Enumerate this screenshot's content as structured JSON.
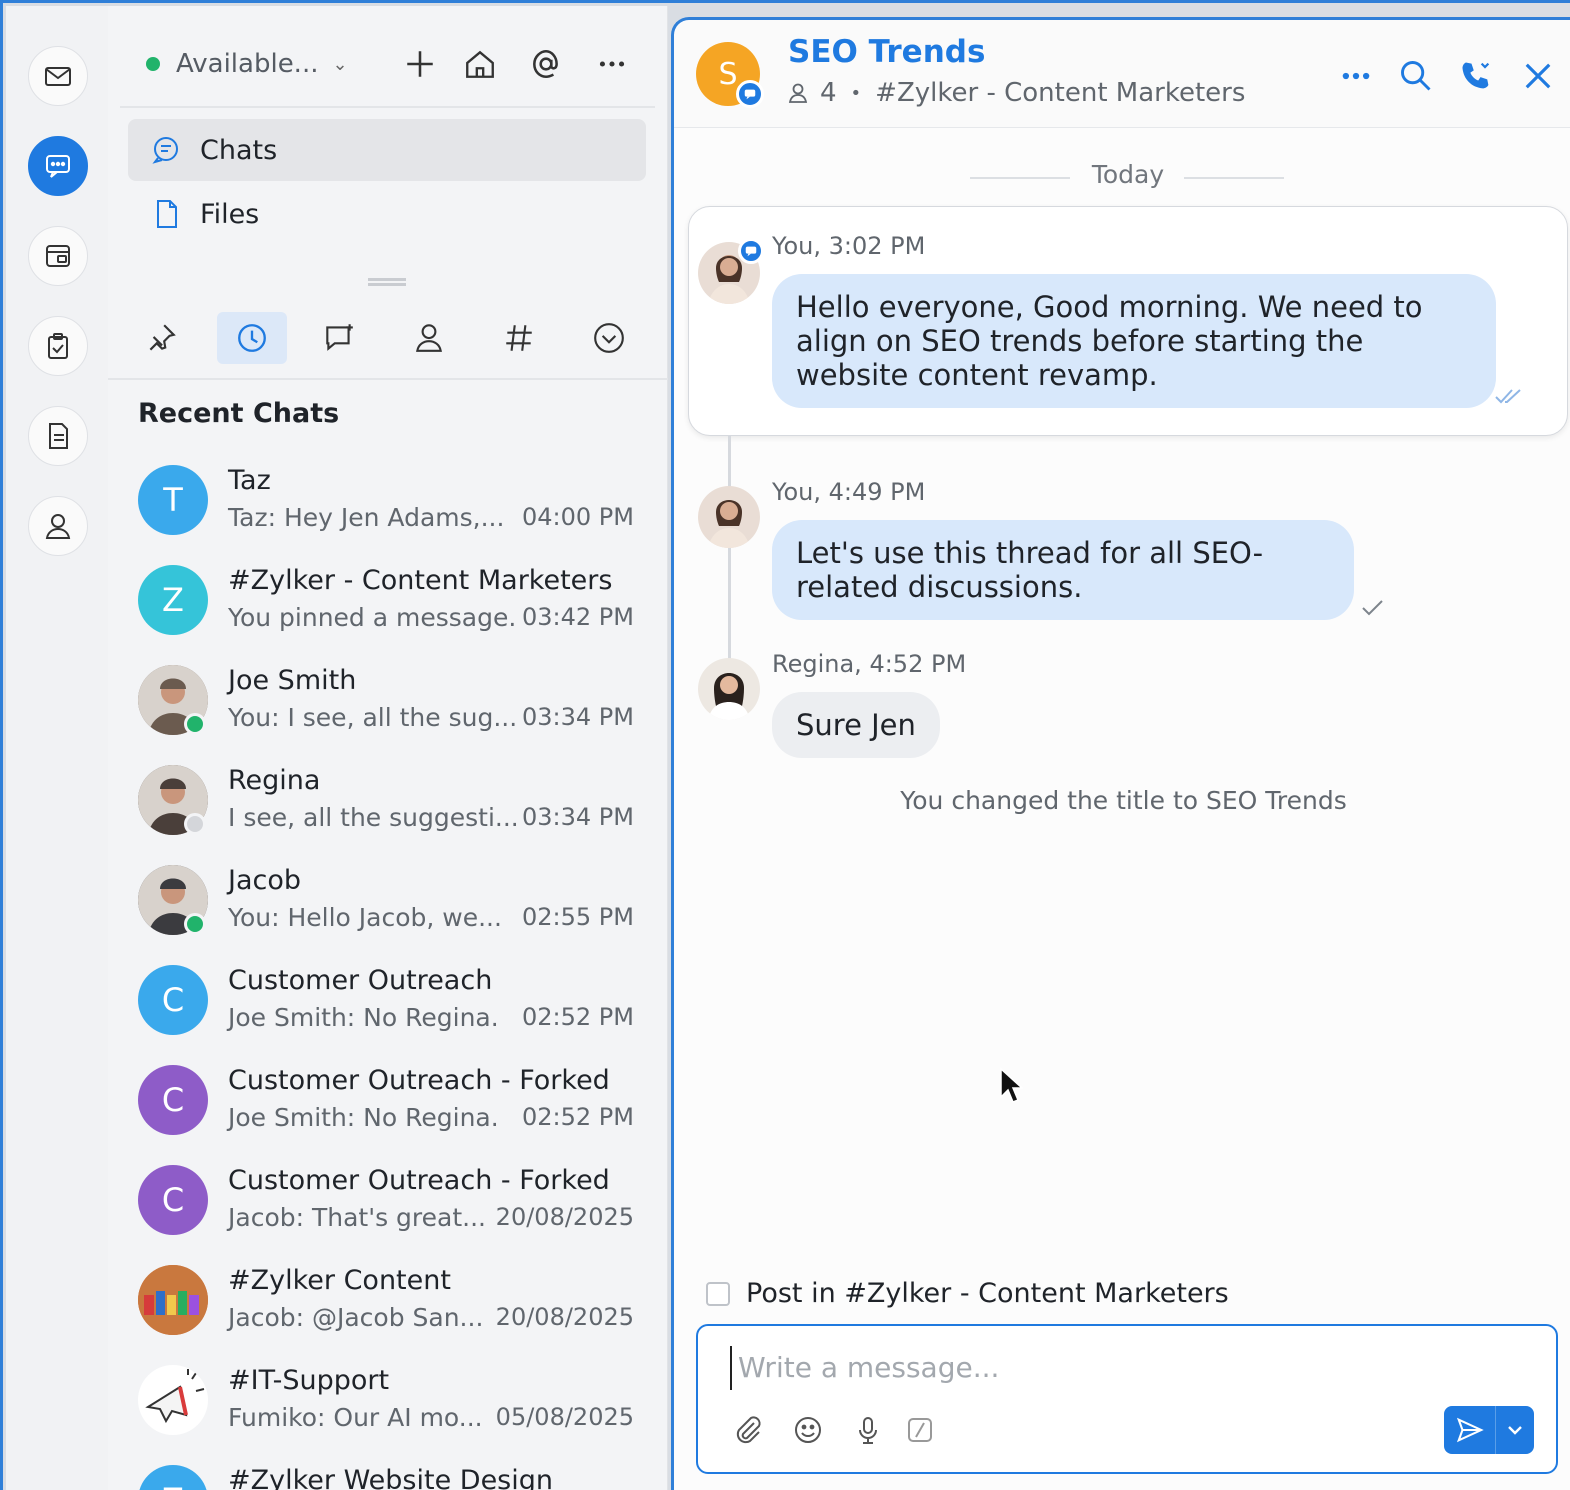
{
  "rail": {
    "items": [
      {
        "name": "mail",
        "icon": "mail-icon"
      },
      {
        "name": "chat",
        "icon": "chat-bubble-icon",
        "active": true
      },
      {
        "name": "calendar",
        "icon": "calendar-box-icon"
      },
      {
        "name": "tasks",
        "icon": "clipboard-check-icon"
      },
      {
        "name": "notes",
        "icon": "document-icon"
      },
      {
        "name": "contacts",
        "icon": "person-icon"
      }
    ]
  },
  "topbar": {
    "status_label": "Available...",
    "status_color": "#21b36b"
  },
  "nav": {
    "chats_label": "Chats",
    "files_label": "Files"
  },
  "filters": [
    "pin-icon",
    "clock-icon",
    "thread-icon",
    "person-icon",
    "hashtag-icon",
    "chevron-down-circle-icon"
  ],
  "list": {
    "section_title": "Recent Chats",
    "chats": [
      {
        "name": "Taz",
        "preview": "Taz: Hey Jen Adams,...",
        "time": "04:00 PM",
        "initial": "T",
        "color": "#3aa9ec"
      },
      {
        "name": "#Zylker - Content Marketers",
        "preview": "You pinned a message.",
        "time": "03:42 PM",
        "initial": "Z",
        "color": "#35c4d9"
      },
      {
        "name": "Joe Smith",
        "preview": "You: I see, all the sug...",
        "time": "03:34 PM",
        "initial": "",
        "color": "#6b5b4f",
        "presence": "#21b36b"
      },
      {
        "name": "Regina",
        "preview": "I see, all the suggesti...",
        "time": "03:34 PM",
        "initial": "",
        "color": "#4a3f3a",
        "presence": "#d4d6da"
      },
      {
        "name": "Jacob",
        "preview": "You: Hello Jacob, we...",
        "time": "02:55 PM",
        "initial": "",
        "color": "#3b3b3f",
        "presence": "#21b36b"
      },
      {
        "name": "Customer Outreach",
        "preview": "Joe Smith: No Regina.",
        "time": "02:52 PM",
        "initial": "C",
        "color": "#3aa9ec"
      },
      {
        "name": "Customer Outreach - Forked",
        "preview": "Joe Smith: No Regina.",
        "time": "02:52 PM",
        "initial": "C",
        "color": "#8e5cc8"
      },
      {
        "name": "Customer Outreach - Forked",
        "preview": "Jacob: That's great...",
        "time": "20/08/2025",
        "initial": "C",
        "color": "#8e5cc8"
      },
      {
        "name": "#Zylker Content",
        "preview": "Jacob: @Jacob San...",
        "time": "20/08/2025",
        "initial": "",
        "color": "#d9733f"
      },
      {
        "name": "#IT-Support",
        "preview": "Fumiko: Our AI mo...",
        "time": "05/08/2025",
        "initial": "",
        "color": "#ffffff"
      },
      {
        "name": "#Zylker Website Design",
        "preview": "",
        "time": "",
        "initial": "Z",
        "color": "#3aa9ec"
      }
    ]
  },
  "chat": {
    "title": "SEO Trends",
    "avatar_initial": "S",
    "member_count": "4",
    "channel": "#Zylker - Content Marketers",
    "day_label": "Today",
    "messages": [
      {
        "author_time": "You, 3:02 PM",
        "text": "Hello everyone, Good morning. We need to align on SEO trends before starting the website content revamp.",
        "status": "read"
      },
      {
        "author_time": "You, 4:49 PM",
        "text": "Let's use this thread for all SEO-related discussions.",
        "status": "sent"
      },
      {
        "author_time": "Regina, 4:52 PM",
        "text": "Sure Jen"
      }
    ],
    "system_message": "You changed the title to SEO Trends",
    "post_in_label": "Post in #Zylker - Content Marketers",
    "composer_placeholder": "Write a message..."
  },
  "colors": {
    "accent": "#1f7ae0",
    "bubble_self": "#d8e8fb",
    "bubble_other": "#eceef1"
  }
}
